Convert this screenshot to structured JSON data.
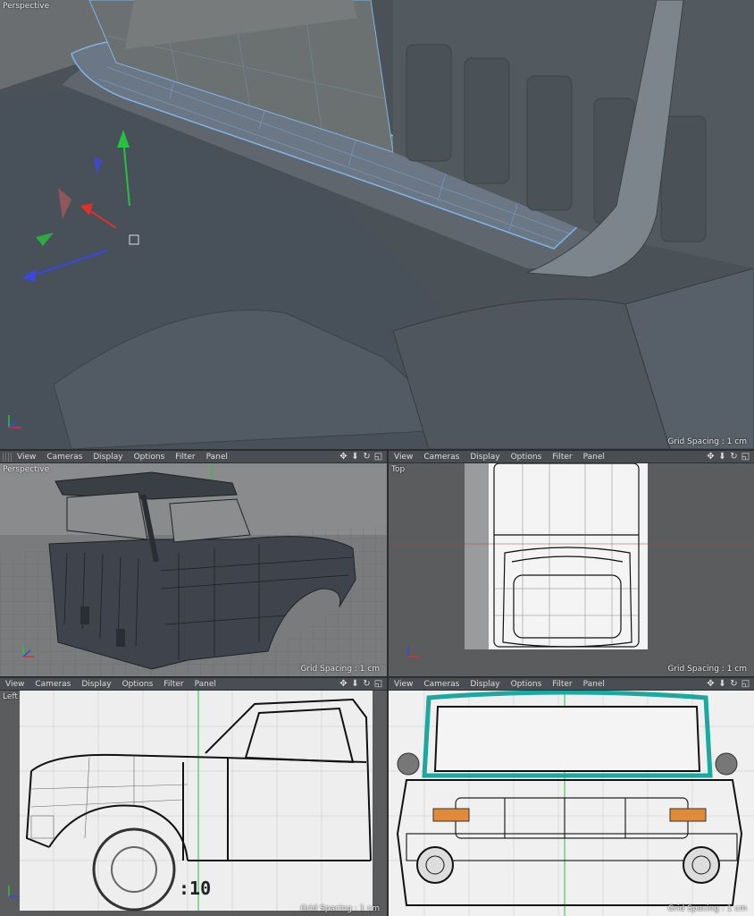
{
  "main_viewport": {
    "label": "Perspective",
    "grid_spacing": "Grid Spacing : 1 cm"
  },
  "panels": [
    {
      "label": "Perspective",
      "grid_spacing": "Grid Spacing : 1 cm"
    },
    {
      "label": "Top",
      "grid_spacing": "Grid Spacing : 1 cm"
    },
    {
      "label": "Left",
      "grid_spacing": "Grid Spacing : 1 cm"
    },
    {
      "label": "",
      "grid_spacing": "Grid Spacing : 1 cm"
    }
  ],
  "menu": [
    "View",
    "Cameras",
    "Display",
    "Options",
    "Filter",
    "Panel"
  ],
  "toolbar_icons": [
    "move-icon",
    "zoom-icon",
    "rotate-icon",
    "maximize-icon"
  ],
  "blueprint_text": {
    "left_number": ":10"
  },
  "colors": {
    "axis_x": "#e0302a",
    "axis_y": "#28c040",
    "axis_z": "#3a48e0",
    "selection": "#5aa8ff",
    "viewport_bg": "#55585c",
    "menubar": "#4a4d51"
  }
}
